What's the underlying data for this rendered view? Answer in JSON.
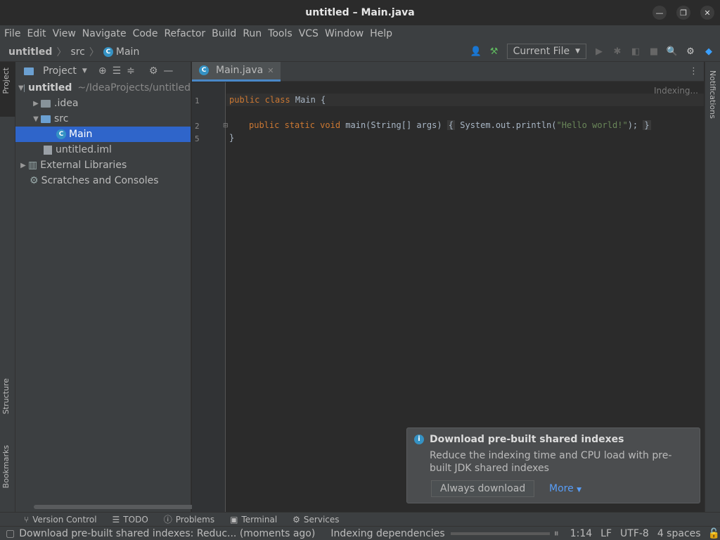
{
  "window": {
    "title": "untitled – Main.java"
  },
  "menu": [
    "File",
    "Edit",
    "View",
    "Navigate",
    "Code",
    "Refactor",
    "Build",
    "Run",
    "Tools",
    "VCS",
    "Window",
    "Help"
  ],
  "breadcrumb": {
    "project": "untitled",
    "folder": "src",
    "file": "Main"
  },
  "toolbar": {
    "run_config": "Current File"
  },
  "sidebar": {
    "project_tab": "Project",
    "structure_tab": "Structure",
    "bookmarks_tab": "Bookmarks",
    "notifications_tab": "Notifications"
  },
  "project_panel": {
    "title": "Project",
    "root_name": "untitled",
    "root_path": "~/IdeaProjects/untitled",
    "items": [
      {
        "label": ".idea"
      },
      {
        "label": "src"
      },
      {
        "label": "Main"
      },
      {
        "label": "untitled.iml"
      },
      {
        "label": "External Libraries"
      },
      {
        "label": "Scratches and Consoles"
      }
    ]
  },
  "editor": {
    "tab": "Main.java",
    "indexing": "Indexing...",
    "lines": [
      "1",
      "2",
      "5"
    ],
    "code": {
      "l1_kw": "public class ",
      "l1_rest": "Main {",
      "l2_kw": "public static void ",
      "l2_sig": "main(String[] args)",
      "l2_open": "{",
      "l2_body_a": " System.out.println(",
      "l2_str": "\"Hello world!\"",
      "l2_body_b": ");",
      "l2_close": "}",
      "l5": "}"
    }
  },
  "notification": {
    "title": "Download pre-built shared indexes",
    "body": "Reduce the indexing time and CPU load with pre-built JDK shared indexes",
    "action": "Always download",
    "more": "More"
  },
  "bottom_tools": [
    "Version Control",
    "TODO",
    "Problems",
    "Terminal",
    "Services"
  ],
  "status": {
    "message": "Download pre-built shared indexes: Reduc... (moments ago)",
    "task": "Indexing dependencies",
    "position": "1:14",
    "line_sep": "LF",
    "encoding": "UTF-8",
    "indent": "4 spaces"
  }
}
